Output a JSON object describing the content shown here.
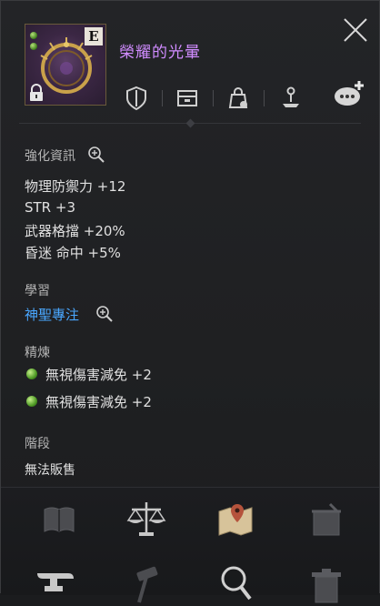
{
  "item": {
    "name": "榮耀的光暈",
    "grade_badge": "E",
    "name_color": "#d08cff"
  },
  "header_icons": [
    "shield-icon",
    "storage-box-icon",
    "bag-icon",
    "figure-pedestal-icon",
    "chat-plus-icon"
  ],
  "enhance": {
    "title": "強化資訊",
    "stats": [
      "物理防禦力 +12",
      "STR +3",
      "武器格擋 +20%",
      "昏迷 命中 +5%"
    ]
  },
  "learning": {
    "title": "學習",
    "skill": "神聖專注",
    "link_color": "#4aa7ff"
  },
  "refine": {
    "title": "精煉",
    "entries": [
      "無視傷害減免 +2",
      "無視傷害減免 +2"
    ]
  },
  "stage": {
    "title": "階段",
    "value": "無法販售"
  },
  "actions": [
    "book-icon",
    "scales-icon",
    "map-pin-icon",
    "trash-bag-icon",
    "anvil-icon",
    "hammer-icon",
    "magnifier-icon",
    "trash-can-icon"
  ]
}
